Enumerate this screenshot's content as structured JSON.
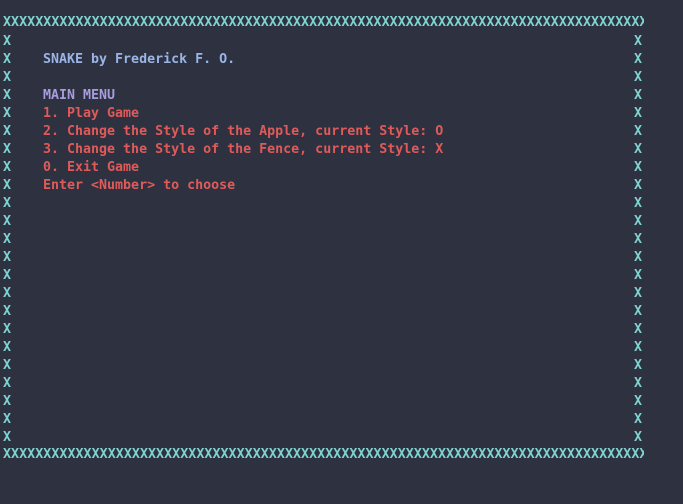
{
  "fence": {
    "top_row": "XXXXXXXXXXXXXXXXXXXXXXXXXXXXXXXXXXXXXXXXXXXXXXXXXXXXXXXXXXXXXXXXXXXXXXXXXXXXXXXXXXX",
    "bottom_row": "XXXXXXXXXXXXXXXXXXXXXXXXXXXXXXXXXXXXXXXXXXXXXXXXXXXXXXXXXXXXXXXXXXXXXXXXXXXXXXXXXXX",
    "side_char": "X",
    "color": "#7fd3d0"
  },
  "title": "SNAKE by Frederick F. O.",
  "menu": {
    "header": "MAIN MENU",
    "items": [
      "1. Play Game",
      "2. Change the Style of the Apple, current Style: O",
      "3. Change the Style of the Fence, current Style: X",
      "0. Exit Game"
    ],
    "prompt": "Enter <Number> to choose"
  },
  "colors": {
    "background": "#2e3240",
    "title": "#9bb4e6",
    "menu_header": "#a79cdc",
    "menu_text": "#e05a5a"
  }
}
